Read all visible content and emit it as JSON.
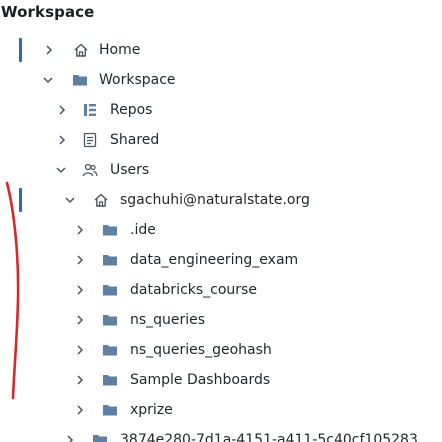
{
  "panel": {
    "title": "Workspace"
  },
  "tree": {
    "home_label": "Home",
    "workspace_label": "Workspace",
    "repos_label": "Repos",
    "shared_label": "Shared",
    "users_label": "Users",
    "user_label": "sgachuhi@naturalstate.org",
    "user_folders": [
      ".ide",
      "data_engineering_exam",
      "databricks_course",
      "ns_queries",
      "ns_queries_geohash",
      "Sample Dashboards",
      "xprize"
    ],
    "next_user_label": "3874e280-7d1a-4151-a411-5c40cf105283"
  },
  "colors": {
    "folder": "#5f7fa3",
    "selection_bar": "#2b6cb0",
    "annotation": "#d42a2a"
  }
}
